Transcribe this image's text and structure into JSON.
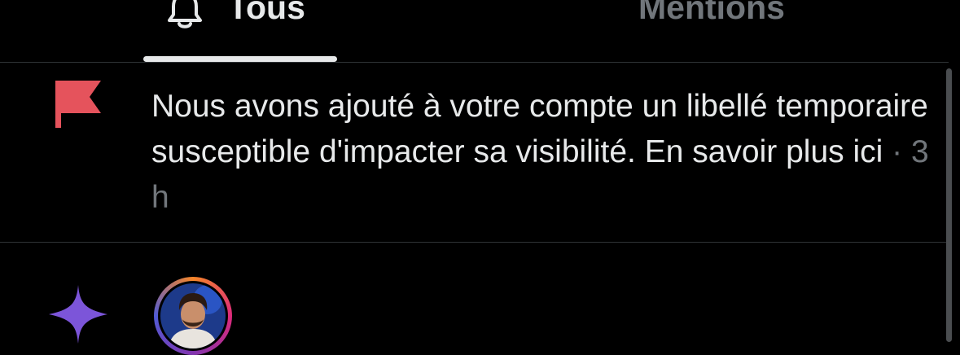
{
  "tabs": {
    "all": {
      "label": "Tous",
      "icon": "bell-icon",
      "active": true
    },
    "mentions": {
      "label": "Mentions",
      "active": false
    }
  },
  "notification": {
    "icon": "flag-icon",
    "icon_color": "#e5535c",
    "message": "Nous avons ajouté à votre compte un libellé temporaire susceptible d'impacter sa visibilité. En savoir plus ici",
    "separator": " · ",
    "time": "3 h"
  },
  "next_notification": {
    "icon": "sparkle-icon",
    "icon_color": "#7c55d9",
    "avatar": "avatar"
  },
  "colors": {
    "background": "#000000",
    "text_primary": "#e7e9ea",
    "text_secondary": "#71767b",
    "divider": "#2f3336"
  }
}
